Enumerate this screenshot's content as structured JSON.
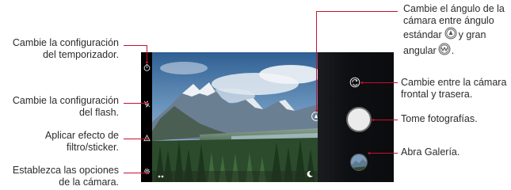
{
  "callouts": {
    "timer": [
      "Cambie la configuración",
      "del temporizador."
    ],
    "flash": [
      "Cambie la configuración",
      "del flash."
    ],
    "filter": [
      "Aplicar efecto de",
      "filtro/sticker."
    ],
    "options": [
      "Establezca las opciones",
      "de la cámara."
    ],
    "angle": [
      "Cambie el ángulo de la",
      "cámara entre ángulo",
      "estándar",
      "y gran",
      "angular"
    ],
    "angle_end": ".",
    "switch": [
      "Cambie entre la cámara",
      "frontal y trasera."
    ],
    "shutter": [
      "Tome fotografías."
    ],
    "gallery": [
      "Abra Galería."
    ]
  },
  "colors": {
    "callout_line": "#c8102e",
    "text": "#2b2b2b",
    "shutter": "#ebebeb"
  },
  "icons": {
    "timer": "timer-icon",
    "flash": "flash-off-icon",
    "filter": "filter-icon",
    "settings": "settings-gear-icon",
    "angle": "wide-angle-icon",
    "switch": "switch-camera-icon",
    "mode": "night-mode-icon",
    "pet": "pet-mode-icon"
  }
}
